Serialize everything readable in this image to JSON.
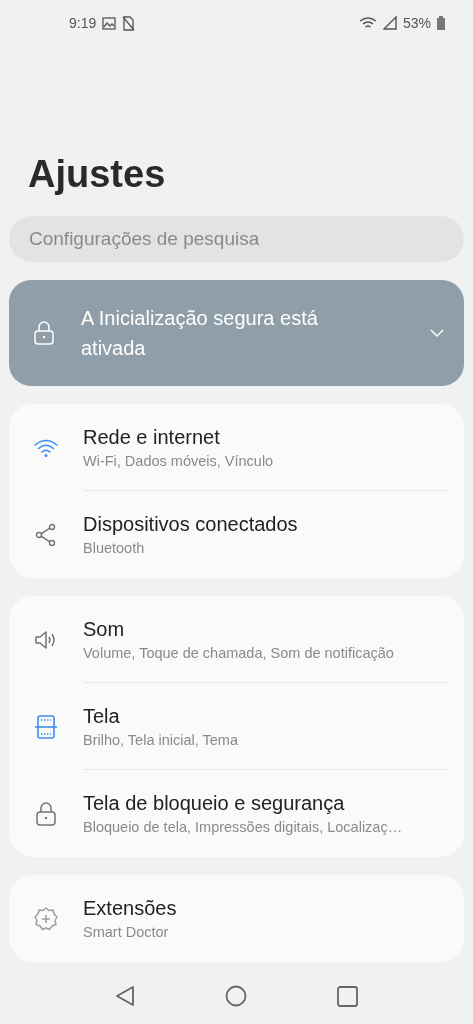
{
  "status_bar": {
    "time": "9:19",
    "battery": "53%"
  },
  "title": "Ajustes",
  "search": {
    "placeholder": "Configurações de pesquisa"
  },
  "banner": {
    "text": "A Inicialização segura está ativada",
    "expanded": false
  },
  "groups": [
    {
      "items": [
        {
          "kind": "wifi",
          "title": "Rede e internet",
          "subtitle": "Wi-Fi, Dados móveis, Vínculo"
        },
        {
          "kind": "share",
          "title": "Dispositivos conectados",
          "subtitle": "Bluetooth"
        }
      ]
    },
    {
      "items": [
        {
          "kind": "sound",
          "title": "Som",
          "subtitle": "Volume, Toque de chamada, Som de notificação"
        },
        {
          "kind": "display",
          "title": "Tela",
          "subtitle": "Brilho, Tela inicial, Tema"
        },
        {
          "kind": "lock",
          "title": "Tela de bloqueio e segurança",
          "subtitle": "Bloqueio de tela, Impressões digitais, Localizaç…"
        }
      ]
    },
    {
      "items": [
        {
          "kind": "gear-plus",
          "title": "Extensões",
          "subtitle": "Smart Doctor"
        }
      ]
    }
  ]
}
